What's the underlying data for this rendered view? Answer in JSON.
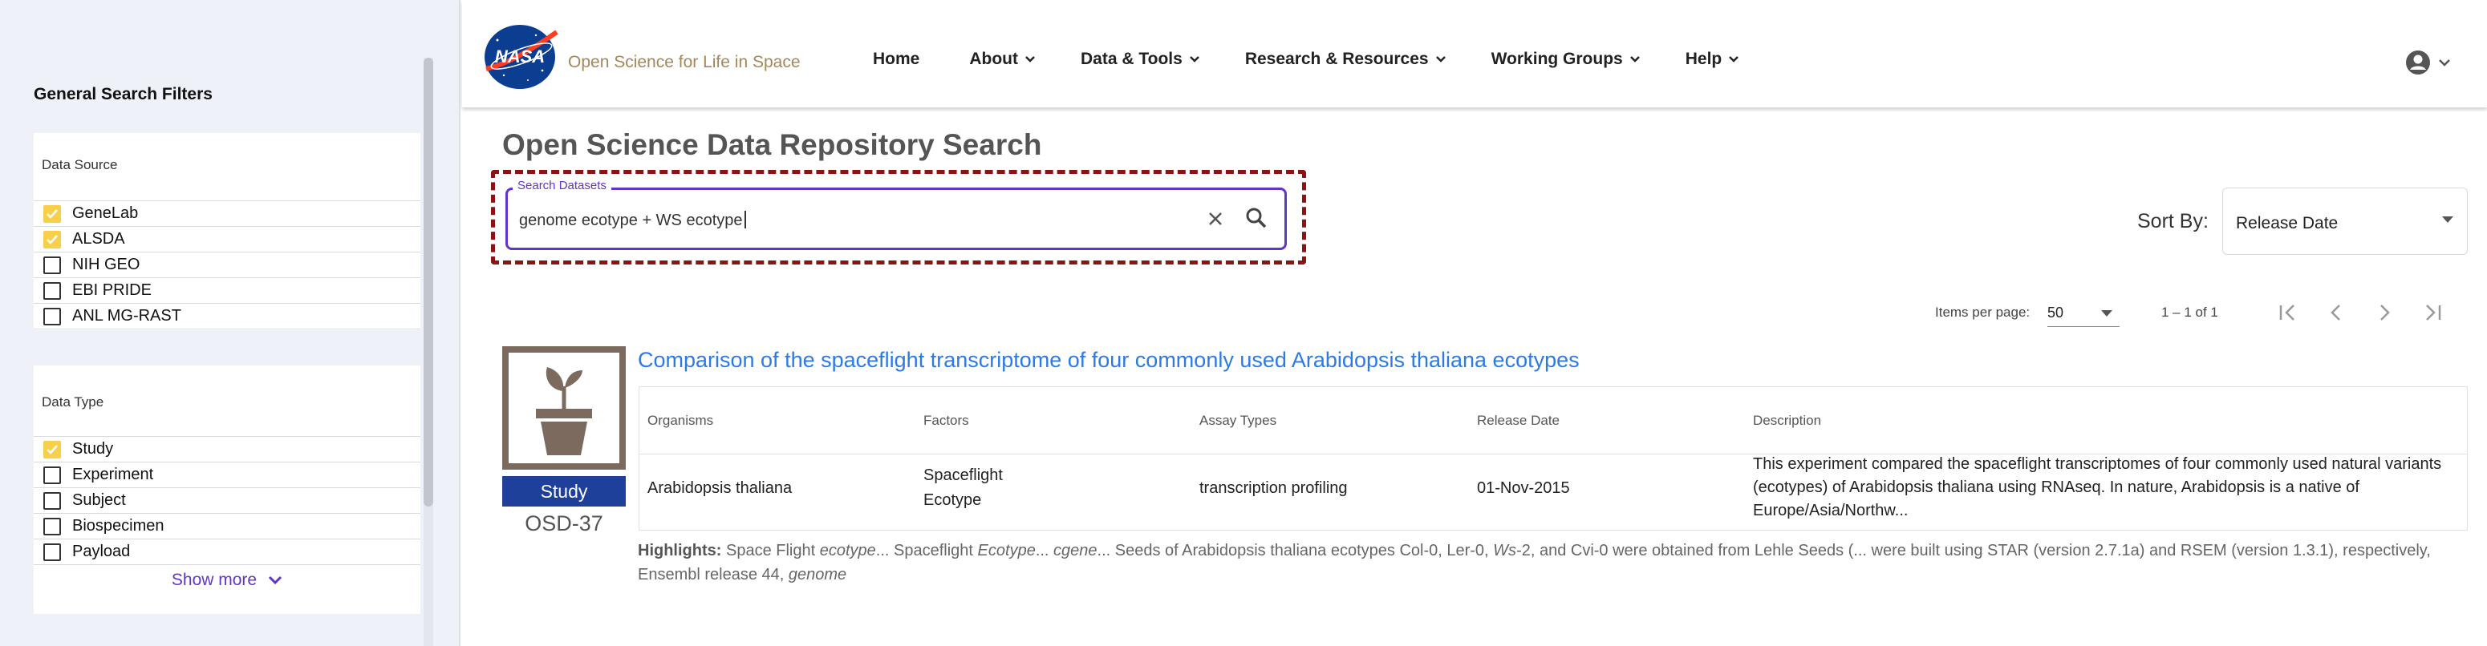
{
  "sidebar": {
    "title": "General Search Filters",
    "data_source": {
      "title": "Data Source",
      "items": [
        {
          "label": "GeneLab",
          "checked": true
        },
        {
          "label": "ALSDA",
          "checked": true
        },
        {
          "label": "NIH GEO",
          "checked": false
        },
        {
          "label": "EBI PRIDE",
          "checked": false
        },
        {
          "label": "ANL MG-RAST",
          "checked": false
        }
      ]
    },
    "data_type": {
      "title": "Data Type",
      "items": [
        {
          "label": "Study",
          "checked": true
        },
        {
          "label": "Experiment",
          "checked": false
        },
        {
          "label": "Subject",
          "checked": false
        },
        {
          "label": "Biospecimen",
          "checked": false
        },
        {
          "label": "Payload",
          "checked": false
        }
      ],
      "show_more": "Show more"
    }
  },
  "header": {
    "logo_text": "NASA",
    "brand": "Open Science for Life in Space",
    "nav": [
      {
        "label": "Home"
      },
      {
        "label": "About"
      },
      {
        "label": "Data & Tools"
      },
      {
        "label": "Research & Resources"
      },
      {
        "label": "Working Groups"
      },
      {
        "label": "Help"
      }
    ]
  },
  "main": {
    "title": "Open Science Data Repository Search",
    "search": {
      "label": "Search Datasets",
      "value": "genome ecotype + WS ecotype"
    },
    "sort": {
      "label": "Sort By:",
      "value": "Release Date"
    },
    "pager": {
      "items_label": "Items per page:",
      "items_value": "50",
      "range": "1 – 1 of 1"
    }
  },
  "result": {
    "badge": "Study",
    "id": "OSD-37",
    "title": "Comparison of the spaceflight transcriptome of four commonly used Arabidopsis thaliana ecotypes",
    "headers": {
      "organisms": "Organisms",
      "factors": "Factors",
      "assay": "Assay Types",
      "release": "Release Date",
      "description": "Description"
    },
    "row": {
      "organisms": "Arabidopsis thaliana",
      "factor1": "Spaceflight",
      "factor2": "Ecotype",
      "assay": "transcription profiling",
      "release": "01-Nov-2015",
      "description": "This experiment compared the spaceflight transcriptomes of four commonly used natural variants (ecotypes) of Arabidopsis thaliana using RNAseq. In nature, Arabidopsis is a native of Europe/Asia/Northw..."
    },
    "highlights": {
      "label": "Highlights:",
      "t1": " Space Flight ",
      "e1": "ecotype",
      "t2": "... Spaceflight ",
      "e2": "Ecotype",
      "t3": "... ",
      "e3": "cgene",
      "t4": "... Seeds of Arabidopsis thaliana ecotypes Col-0, Ler-0, ",
      "e4": "Ws",
      "t5": "-2, and Cvi-0 were obtained from Lehle Seeds (... were built using STAR (version 2.7.1a) and RSEM (version 1.3.1), respectively, Ensembl release 44, ",
      "e5": "genome"
    }
  },
  "colors": {
    "accent": "#6236c5",
    "link": "#2c7be5",
    "checked": "#f7cf4b",
    "badge": "#1e3f9a",
    "highlight_border": "#8a1414",
    "brand": "#a6875a"
  }
}
